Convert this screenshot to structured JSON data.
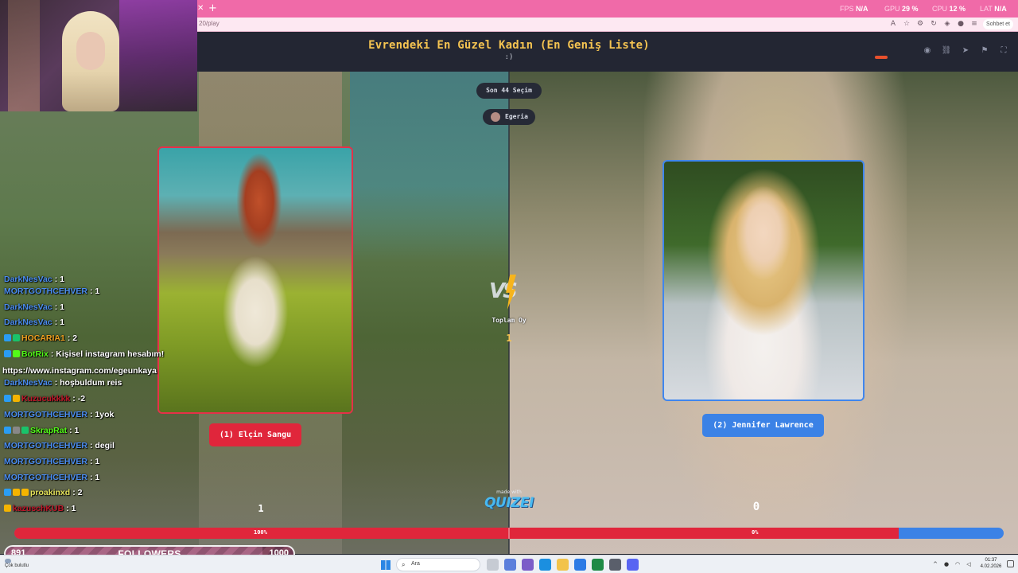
{
  "browser": {
    "url": "20/play",
    "chat_button": "Sohbet et",
    "perf": [
      {
        "label": "FPS",
        "value": "N/A"
      },
      {
        "label": "GPU",
        "value": "29 %"
      },
      {
        "label": "CPU",
        "value": "12 %"
      },
      {
        "label": "LAT",
        "value": "N/A"
      }
    ]
  },
  "quiz": {
    "title": "Evrendeki En Güzel Kadın (En Geniş Liste)",
    "subtitle": ":)",
    "selection_count": "Son 44 Seçim",
    "user": "Egeria",
    "vs_text": "VS",
    "total_label": "Toplam Oy",
    "total_value": "1",
    "left": {
      "name": "(1) Elçin Sangu",
      "score": "1",
      "percent_label": "100%",
      "percent": 89.4
    },
    "right": {
      "name": "(2) Jennifer Lawrence",
      "score": "0",
      "percent_label": "0%"
    },
    "made_with": "made with",
    "brand": "QUIZEI"
  },
  "chat": [
    {
      "user": "DarkNesVac",
      "text": ": 1",
      "color": "#4b8df0",
      "badges": []
    },
    {
      "user": "MORTGOTHCEHVER",
      "text": ": 1",
      "color": "#4b8df0",
      "badges": []
    },
    {
      "user": "DarkNesVac",
      "text": ": 1",
      "color": "#4b8df0",
      "badges": []
    },
    {
      "user": "DarkNesVac",
      "text": ": 1",
      "color": "#4b8df0",
      "badges": []
    },
    {
      "user": "HOCARIA1",
      "text": ": 2",
      "color": "#f0a020",
      "badges": [
        "#2a9df4",
        "#19c36a"
      ]
    },
    {
      "user": "BotRix",
      "text": ": Kişisel instagram hesabım!",
      "color": "#53fc18",
      "badges": [
        "#2a9df4",
        "#53fc18"
      ]
    },
    {
      "user": "",
      "text": "https://www.instagram.com/egeunkaya",
      "color": "#ffffff",
      "badges": [],
      "wrap": true
    },
    {
      "user": "DarkNesVac",
      "text": ": hoşbuldum reis",
      "color": "#4b8df0",
      "badges": []
    },
    {
      "user": "Kuzucukkkk",
      "text": ": -2",
      "color": "#c0182a",
      "badges": [
        "#2a9df4",
        "#f4b400"
      ]
    },
    {
      "user": "MORTGOTHCEHVER",
      "text": ": 1yok",
      "color": "#4b8df0",
      "badges": []
    },
    {
      "user": "SkrapRat",
      "text": ": 1",
      "color": "#53fc18",
      "badges": [
        "#2a9df4",
        "#888888",
        "#19c36a"
      ]
    },
    {
      "user": "MORTGOTHCEHVER",
      "text": ": degil",
      "color": "#4b8df0",
      "badges": []
    },
    {
      "user": "MORTGOTHCEHVER",
      "text": ": 1",
      "color": "#4b8df0",
      "badges": []
    },
    {
      "user": "MORTGOTHCEHVER",
      "text": ": 1",
      "color": "#4b8df0",
      "badges": []
    },
    {
      "user": "proakinxd",
      "text": ": 2",
      "color": "#e6e45a",
      "badges": [
        "#2a9df4",
        "#f4b400",
        "#f4b400"
      ]
    },
    {
      "user": "kazuschKUB",
      "text": ": 1",
      "color": "#c0182a",
      "badges": [
        "#f4b400"
      ]
    }
  ],
  "followers": {
    "current": "891",
    "label": "FOLLOWERS",
    "goal": "1000",
    "progress": 0.891
  },
  "taskbar": {
    "weather": "Çok bulutlu",
    "search_placeholder": "Ara",
    "time": "01:37",
    "date": "4.02.2026"
  },
  "colors": {
    "left_accent": "#e0263b",
    "right_accent": "#3b82e6",
    "title": "#f5c451"
  }
}
